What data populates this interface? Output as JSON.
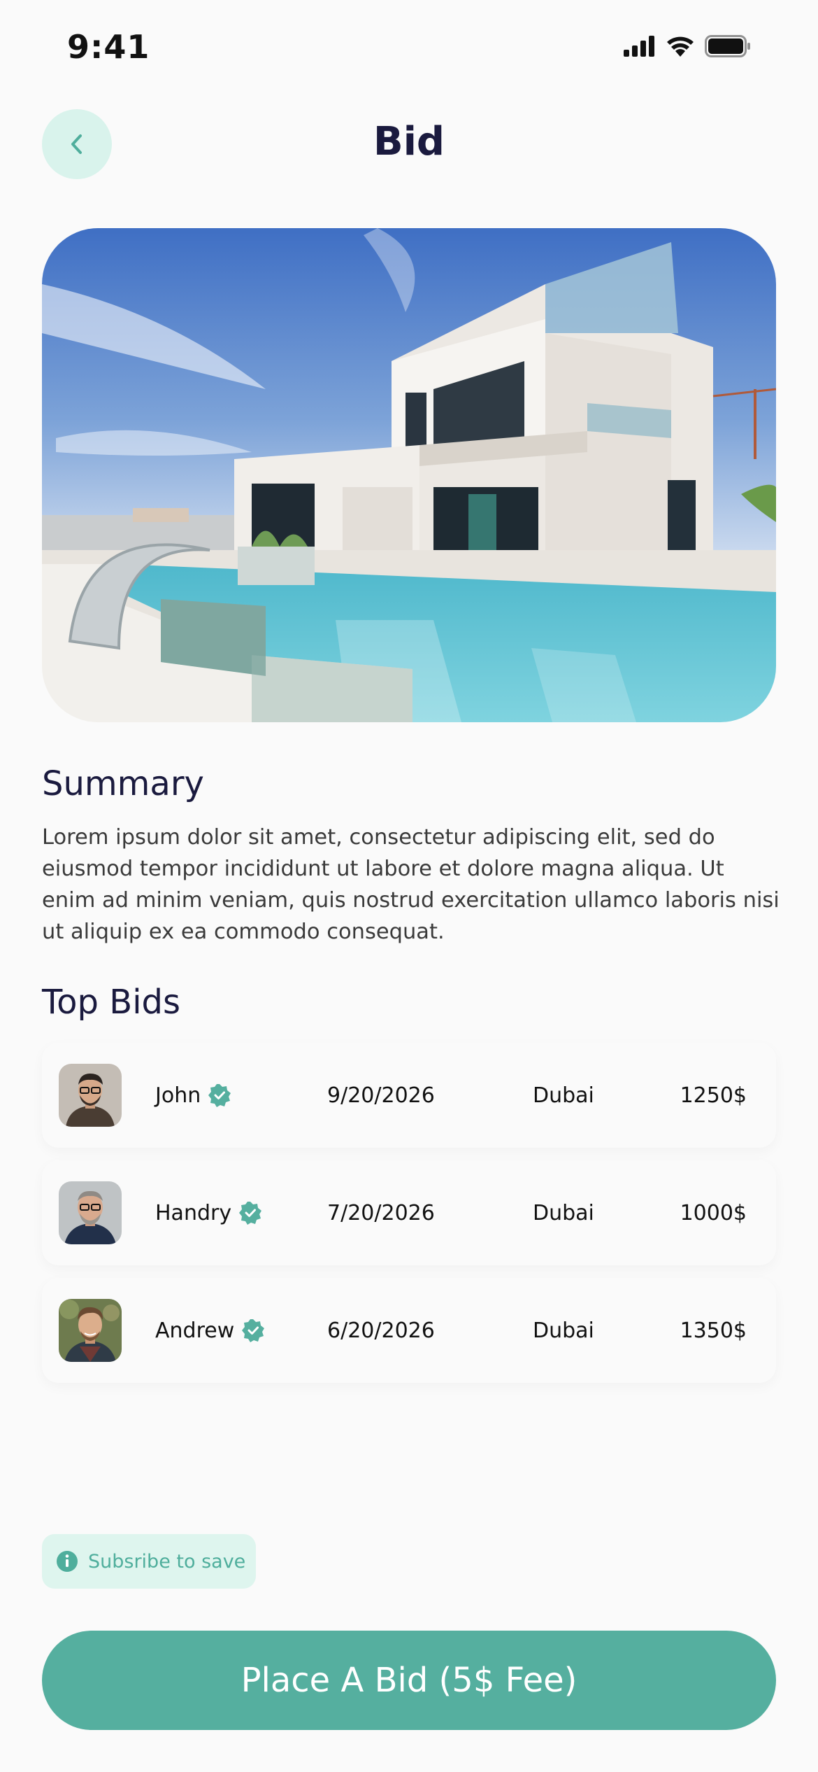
{
  "status_bar": {
    "time": "9:41",
    "icons": [
      "signal-icon",
      "wifi-icon",
      "battery-icon"
    ]
  },
  "header": {
    "title": "Bid",
    "back_icon": "chevron-left-icon"
  },
  "hero": {
    "image": "modern-villa-with-pool-photo"
  },
  "summary": {
    "title": "Summary",
    "text": "Lorem ipsum dolor sit amet, consectetur adipiscing elit, sed do eiusmod tempor incididunt ut labore et dolore magna aliqua. Ut enim ad minim veniam, quis nostrud exercitation ullamco laboris nisi ut aliquip ex ea commodo consequat."
  },
  "top_bids": {
    "title": "Top Bids",
    "rows": [
      {
        "name": "John",
        "date": "9/20/2026",
        "city": "Dubai",
        "amount": "1250$",
        "verified_icon": "verified-badge-icon"
      },
      {
        "name": "Handry",
        "date": "7/20/2026",
        "city": "Dubai",
        "amount": "1000$",
        "verified_icon": "verified-badge-icon"
      },
      {
        "name": "Andrew",
        "date": "6/20/2026",
        "city": "Dubai",
        "amount": "1350$",
        "verified_icon": "verified-badge-icon"
      }
    ]
  },
  "subscribe": {
    "label": "Subsribe to save",
    "icon": "info-icon"
  },
  "cta": {
    "label": "Place A Bid (5$ Fee)"
  },
  "colors": {
    "accent": "#55af9f",
    "accent_light": "#def5ee",
    "title": "#1a1a3e",
    "background": "#fafafa"
  }
}
